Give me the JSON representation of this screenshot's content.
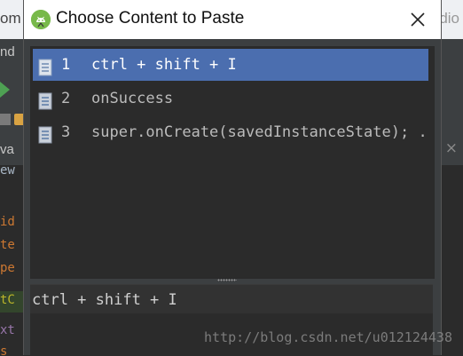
{
  "background": {
    "window_title_left": "om",
    "window_title_right": "dio",
    "menu_fragment": "nd",
    "tab_fragment": "va",
    "tab_close": "×",
    "code_fragments": [
      {
        "text": "ew",
        "color": "#a9b7c6"
      },
      {
        "text": "id",
        "color": "#cc7832"
      },
      {
        "text": "te",
        "color": "#cc7832"
      },
      {
        "text": "pe",
        "color": "#cc7832"
      },
      {
        "text": "tC",
        "color": "#bbb529"
      },
      {
        "text": "xt",
        "color": "#9876aa"
      },
      {
        "text": "s",
        "color": "#cc7832"
      }
    ]
  },
  "dialog": {
    "title": "Choose Content to Paste",
    "items": [
      {
        "index": "1",
        "text": "ctrl + shift + I",
        "selected": true
      },
      {
        "index": "2",
        "text": "onSuccess",
        "selected": false
      },
      {
        "index": "3",
        "text": "super.onCreate(savedInstanceState); ...",
        "selected": false
      }
    ],
    "preview_text": "ctrl + shift + I"
  },
  "watermark": "http://blog.csdn.net/u012124438",
  "colors": {
    "selection": "#4b6eaf",
    "list_bg": "#2b2b2b",
    "panel_bg": "#3c3f41",
    "android_green": "#78b94a"
  },
  "icons": {
    "app_logo": "android-studio-logo",
    "close": "close-icon",
    "item": "text-document-icon"
  }
}
